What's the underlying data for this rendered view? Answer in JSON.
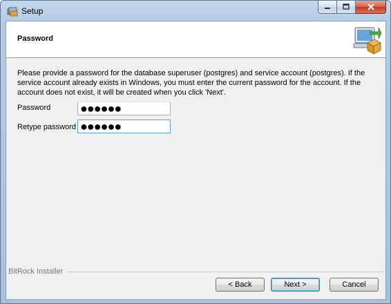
{
  "window": {
    "title": "Setup",
    "controls": {
      "minimize": "–",
      "maximize": "□",
      "close": "✕"
    }
  },
  "header": {
    "title": "Password",
    "icon": "computer-install-icon"
  },
  "description": "Please provide a password for the database superuser (postgres) and service account (postgres). If the service account already exists in Windows, you must enter the current password for the account. If the account does not exist, it will be created when you click 'Next'.",
  "fields": {
    "password": {
      "label": "Password",
      "masked_value": "●●●●●●"
    },
    "retype": {
      "label": "Retype password",
      "masked_value": "●●●●●●"
    }
  },
  "footer": {
    "brand": "BitRock Installer",
    "back_label": "< Back",
    "next_label": "Next >",
    "cancel_label": "Cancel"
  },
  "colors": {
    "titlebar": "#b6cbe4",
    "dialog_bg": "#f0f0f0",
    "close_button": "#c2371c",
    "focus_border": "#569de5"
  }
}
